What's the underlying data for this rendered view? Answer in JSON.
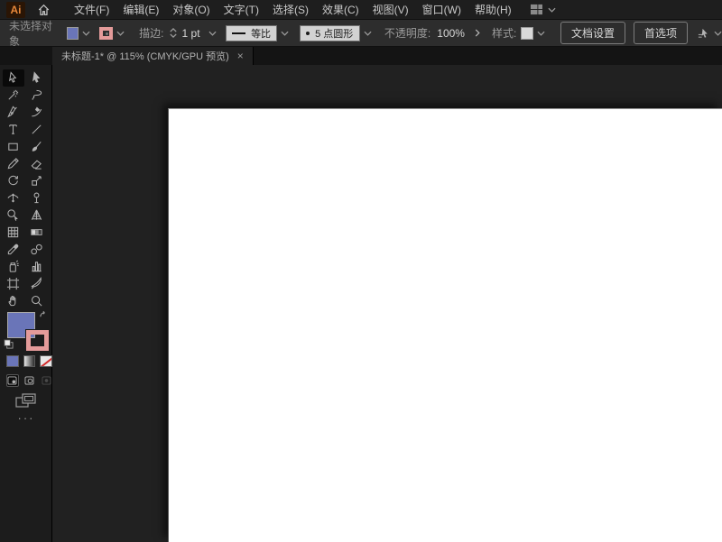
{
  "app": {
    "logo_text": "Ai"
  },
  "menu_bar": {
    "items": [
      "文件(F)",
      "编辑(E)",
      "对象(O)",
      "文字(T)",
      "选择(S)",
      "效果(C)",
      "视图(V)",
      "窗口(W)",
      "帮助(H)"
    ]
  },
  "control_bar": {
    "no_selection_label": "未选择对象",
    "fill_color": "#6a75b8",
    "stroke_color": "#e49b9a",
    "stroke_label": "描边:",
    "stroke_weight": "1 pt",
    "width_profile_label": "等比",
    "brush_label": "5 点圆形",
    "opacity_label": "不透明度:",
    "opacity_value": "100%",
    "style_label": "样式:",
    "style_swatch_color": "#d9d9d9",
    "document_setup_label": "文档设置",
    "preferences_label": "首选项"
  },
  "tab_bar": {
    "active_tab": {
      "title": "未标题-1* @ 115% (CMYK/GPU 预览)",
      "close_glyph": "×"
    }
  },
  "toolbar": {
    "tools": [
      "selection",
      "direct-selection",
      "magic-wand",
      "lasso",
      "pen",
      "curvature",
      "type",
      "line-segment",
      "rectangle",
      "paintbrush",
      "pencil",
      "eraser",
      "rotate",
      "scale",
      "width",
      "puppet-warp",
      "shape-builder",
      "perspective-grid",
      "mesh",
      "gradient",
      "eyedropper",
      "blend",
      "symbol-sprayer",
      "column-graph",
      "artboard",
      "slice",
      "hand",
      "zoom"
    ],
    "selected_tool": "selection",
    "fill_color": "#6a75b8",
    "stroke_color": "#e49b9a",
    "more_label": "···"
  },
  "canvas": {
    "artboard_color": "#ffffff",
    "pasteboard_color": "#212121"
  }
}
